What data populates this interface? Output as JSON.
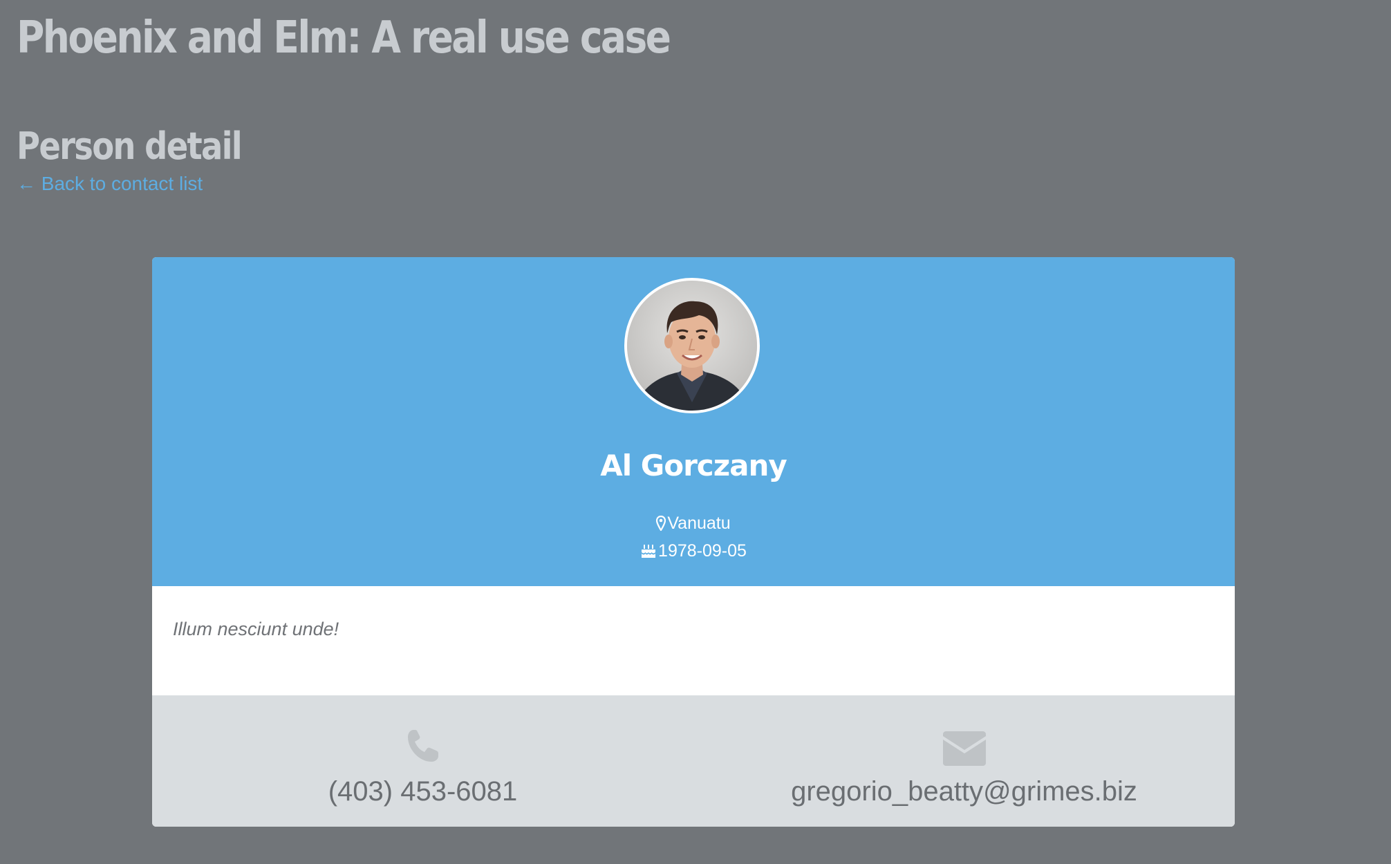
{
  "app": {
    "title": "Phoenix and Elm: A real use case"
  },
  "page": {
    "title": "Person detail",
    "back_link": "← Back to contact list"
  },
  "person": {
    "name": "Al Gorczany",
    "location": "Vanuatu",
    "birth_date": "1978-09-05",
    "bio": "Illum nesciunt unde!",
    "phone": "(403) 453-6081",
    "email": "gregorio_beatty@grimes.biz"
  },
  "icons": {
    "location": "map-marker-icon",
    "birthday": "birthday-cake-icon",
    "phone": "phone-icon",
    "email": "envelope-icon"
  },
  "colors": {
    "page_background": "#717579",
    "heading_text": "#c8ccd0",
    "link": "#5dade2",
    "card_header": "#5dade2",
    "card_body": "#ffffff",
    "card_footer": "#d9dde0",
    "muted_text": "#6a6e72"
  }
}
